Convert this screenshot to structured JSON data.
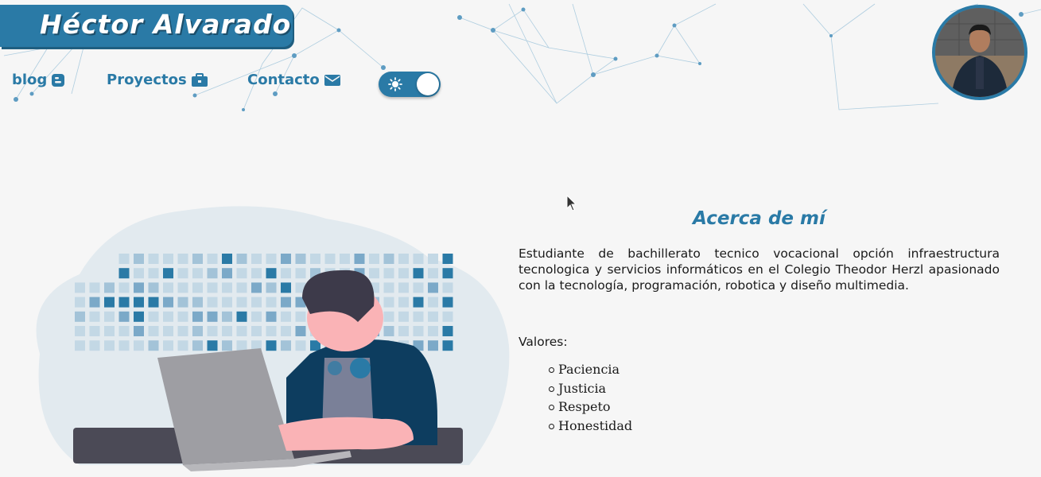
{
  "header": {
    "title": "Héctor Alvarado",
    "accent_color": "#2a7aa6",
    "nav": [
      {
        "label": "blog",
        "icon": "blogger-icon"
      },
      {
        "label": "Proyectos",
        "icon": "briefcase-icon"
      },
      {
        "label": "Contacto",
        "icon": "envelope-icon"
      }
    ],
    "theme_toggle": {
      "icon": "sun-icon",
      "state": "light"
    },
    "avatar": "profile-photo"
  },
  "about": {
    "title": "Acerca de mí",
    "description": "Estudiante de bachillerato tecnico vocacional opción infraestructura tecnologica y servicios informáticos en el Colegio Theodor Herzl apasionado con la tecnología, programación, robotica y diseño multimedia.",
    "values_title": "Valores:",
    "values": [
      "Paciencia",
      "Justicia",
      "Respeto",
      "Honestidad"
    ]
  }
}
